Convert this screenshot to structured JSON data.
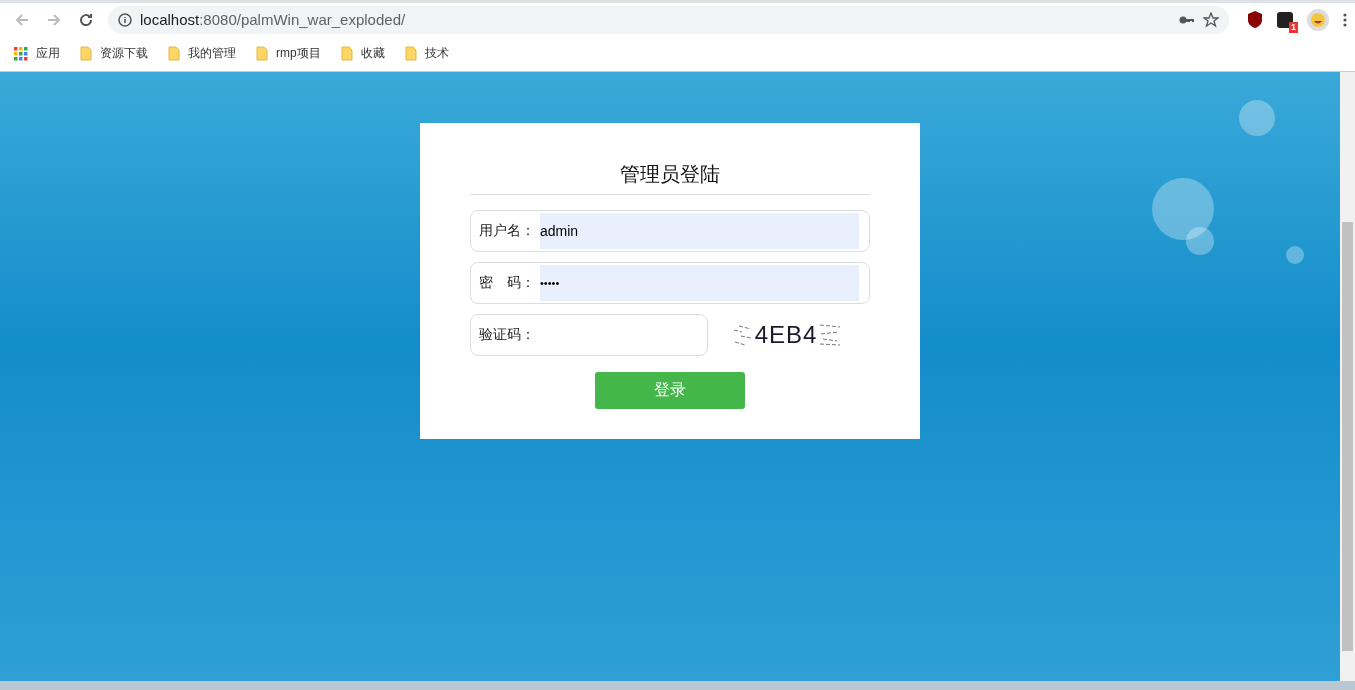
{
  "browser": {
    "url_host": "localhost",
    "url_path": ":8080/palmWin_war_exploded/",
    "extension_badge": "1"
  },
  "bookmarks": [
    {
      "label": "应用",
      "kind": "apps"
    },
    {
      "label": "资源下载",
      "kind": "folder"
    },
    {
      "label": "我的管理",
      "kind": "folder"
    },
    {
      "label": "rmp项目",
      "kind": "folder"
    },
    {
      "label": "收藏",
      "kind": "folder"
    },
    {
      "label": "技术",
      "kind": "folder"
    }
  ],
  "login": {
    "title": "管理员登陆",
    "fields": [
      {
        "label": "用户名：",
        "value": "admin",
        "kind": "text",
        "autofilled": true
      },
      {
        "label": "密　码：",
        "value": "•••••",
        "kind": "password",
        "autofilled": true
      }
    ],
    "captcha": {
      "label": "验证码：",
      "code": "4EB4"
    },
    "submit": "登录"
  }
}
